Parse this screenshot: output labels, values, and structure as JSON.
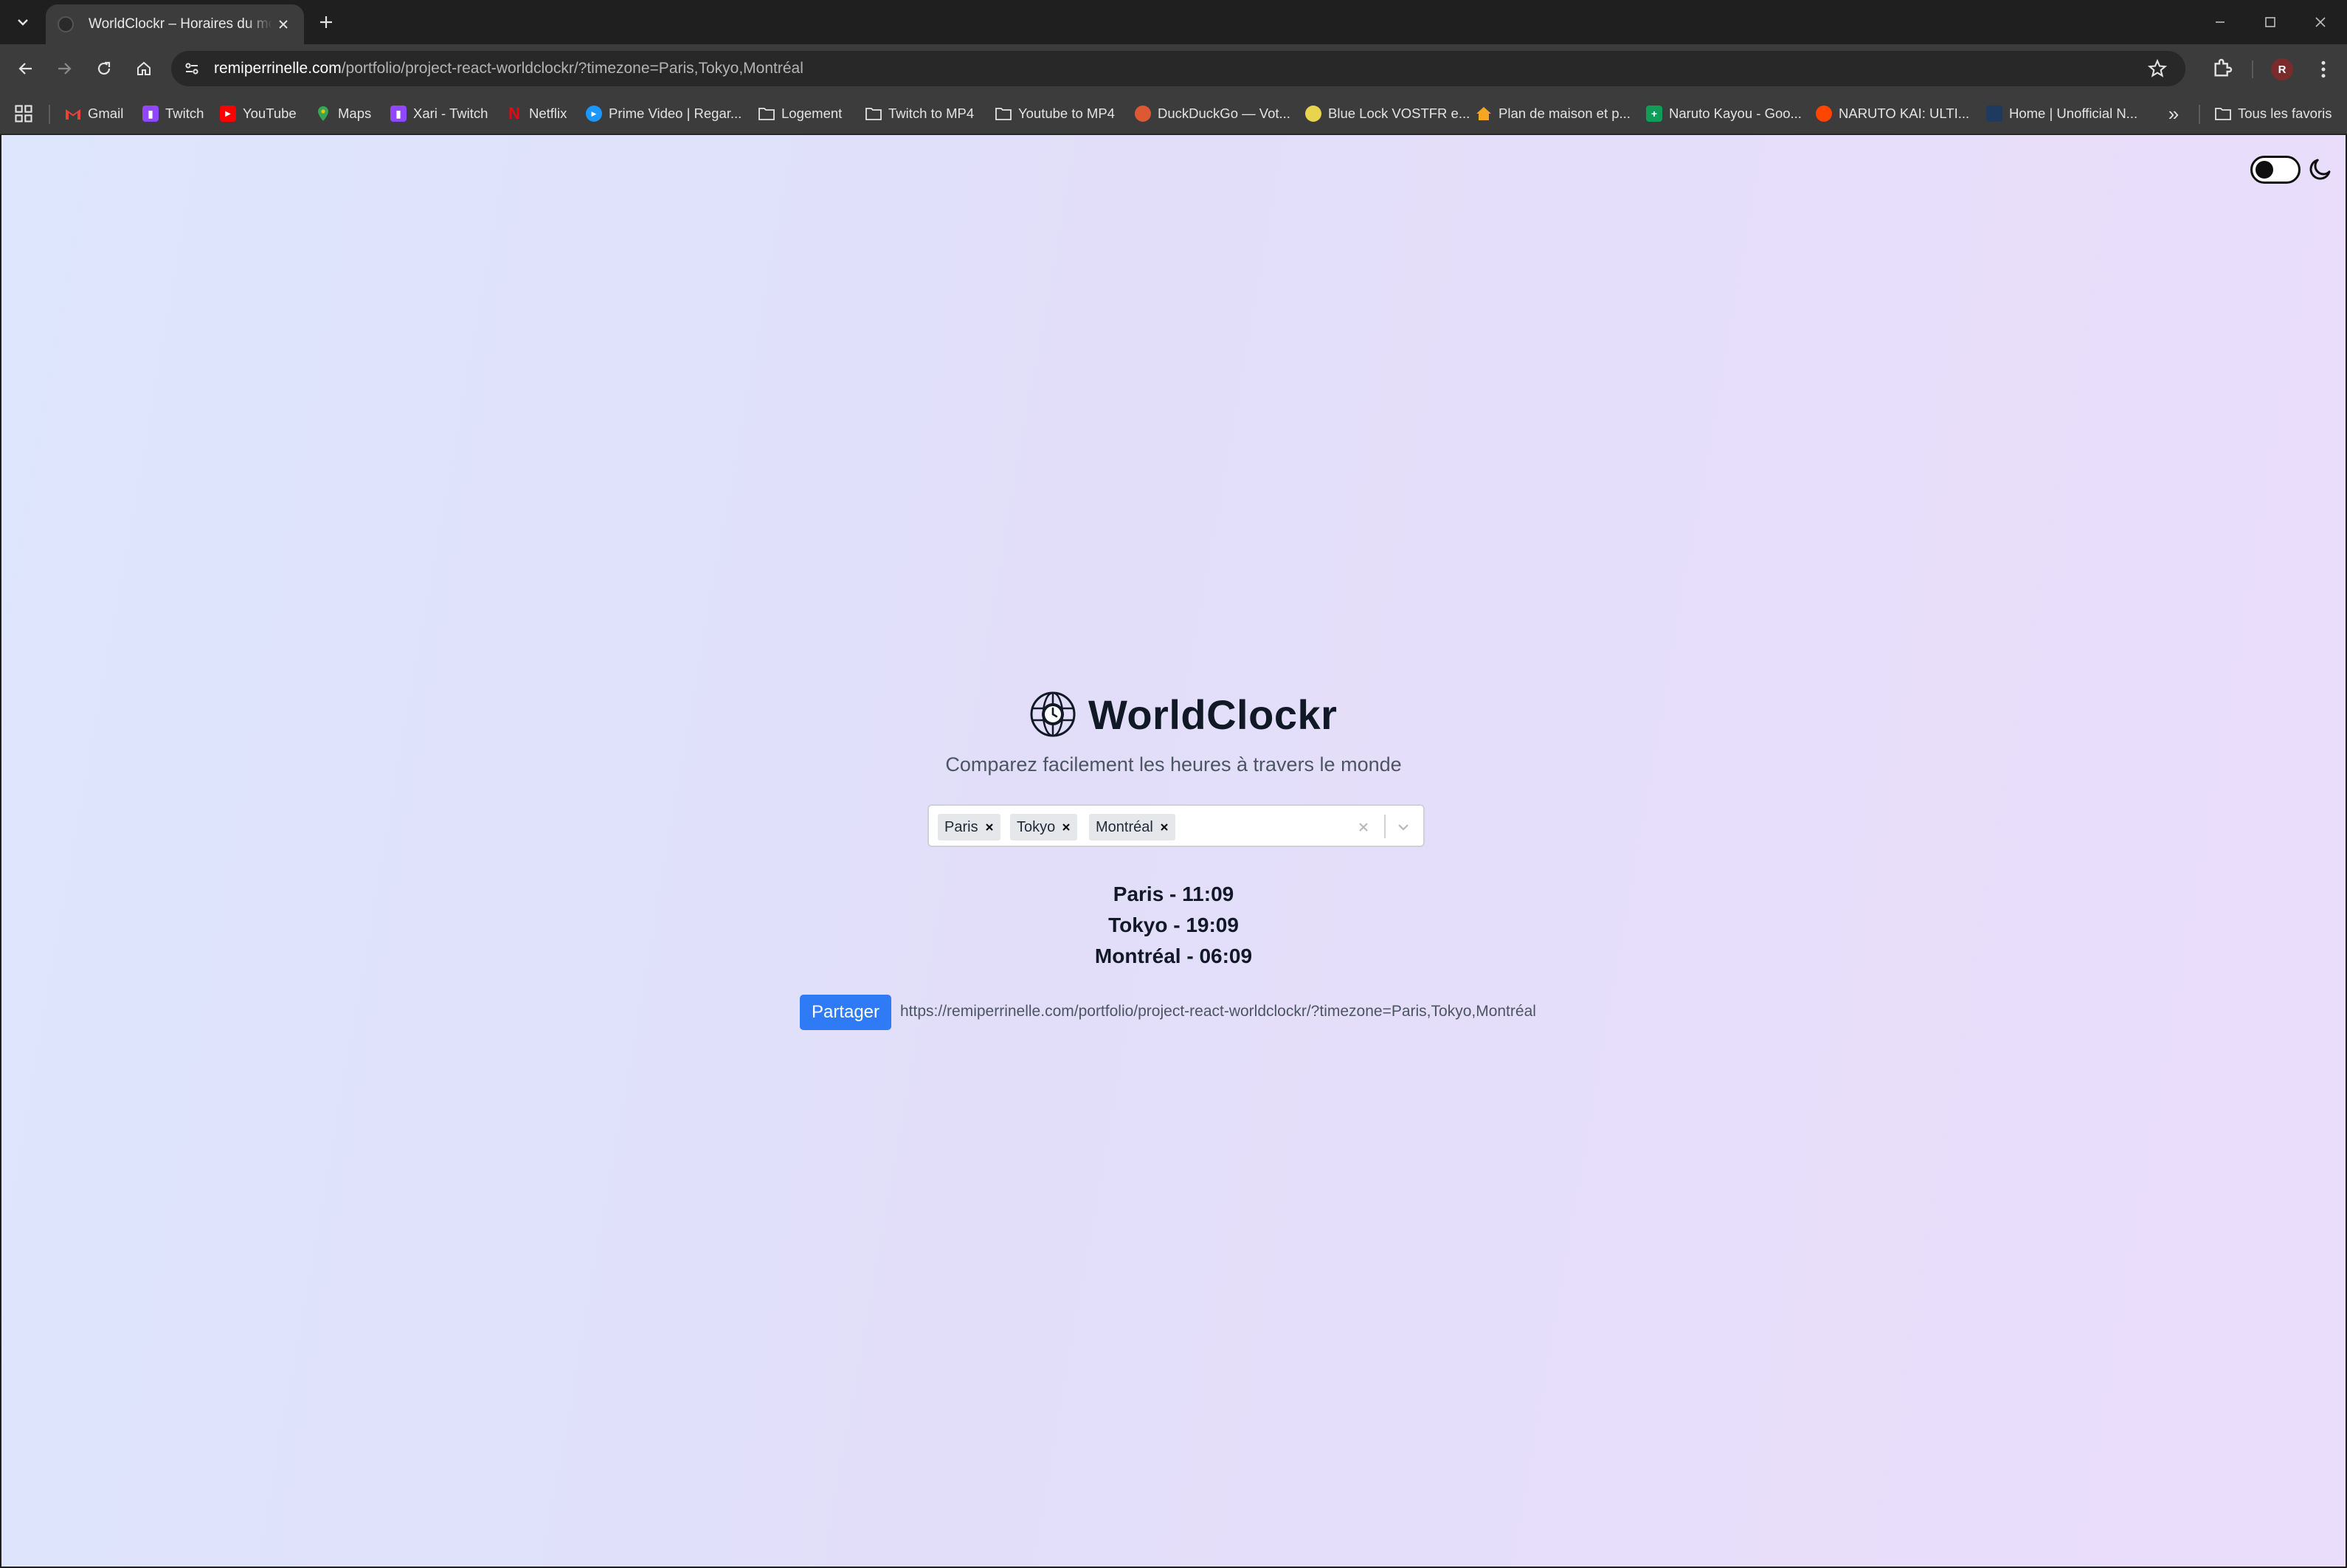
{
  "browser": {
    "tab": {
      "title": "WorldClockr – Horaires du monde"
    },
    "address": {
      "host": "remiperrinelle.com",
      "path": "/portfolio/project-react-worldclockr/?timezone=Paris,Tokyo,Montréal"
    },
    "profile_initial": "R",
    "bookmarks": [
      {
        "label": "Gmail",
        "icon": "gmail-icon",
        "color": "#ea4335"
      },
      {
        "label": "Twitch",
        "icon": "twitch-icon",
        "color": "#9146ff"
      },
      {
        "label": "YouTube",
        "icon": "youtube-icon",
        "color": "#ff0000"
      },
      {
        "label": "Maps",
        "icon": "maps-icon",
        "color": "#34a853"
      },
      {
        "label": "Xari - Twitch",
        "icon": "twitch-icon",
        "color": "#9146ff"
      },
      {
        "label": "Netflix",
        "icon": "netflix-icon",
        "color": "#e50914"
      },
      {
        "label": "Prime Video | Regar...",
        "icon": "prime-video-icon",
        "color": "#1a98ff"
      },
      {
        "label": "Logement",
        "icon": "folder-icon",
        "color": "#e3e3e3"
      },
      {
        "label": "Twitch to MP4",
        "icon": "folder-icon",
        "color": "#e3e3e3"
      },
      {
        "label": "Youtube to MP4",
        "icon": "folder-icon",
        "color": "#e3e3e3"
      },
      {
        "label": "DuckDuckGo — Vot...",
        "icon": "duckduckgo-icon",
        "color": "#de5833"
      },
      {
        "label": "Blue Lock VOSTFR e...",
        "icon": "site-icon",
        "color": "#e8d44d"
      },
      {
        "label": "Plan de maison et p...",
        "icon": "house-icon",
        "color": "#f5a623"
      },
      {
        "label": "Naruto Kayou - Goo...",
        "icon": "sheets-icon",
        "color": "#0f9d58"
      },
      {
        "label": "NARUTO KAI: ULTI...",
        "icon": "reddit-icon",
        "color": "#ff4500"
      },
      {
        "label": "Home | Unofficial N...",
        "icon": "site-icon",
        "color": "#1e3a5f"
      }
    ],
    "all_bookmarks_label": "Tous les favoris"
  },
  "page": {
    "title": "WorldClockr",
    "subtitle": "Comparez facilement les heures à travers le monde",
    "selected_zones": [
      "Paris",
      "Tokyo",
      "Montréal"
    ],
    "times": [
      "Paris - 11:09",
      "Tokyo - 19:09",
      "Montréal - 06:09"
    ],
    "share_label": "Partager",
    "share_url": "https://remiperrinelle.com/portfolio/project-react-worldclockr/?timezone=Paris,Tokyo,Montréal",
    "colors": {
      "accent": "#2f7bf5",
      "title": "#111826"
    }
  }
}
